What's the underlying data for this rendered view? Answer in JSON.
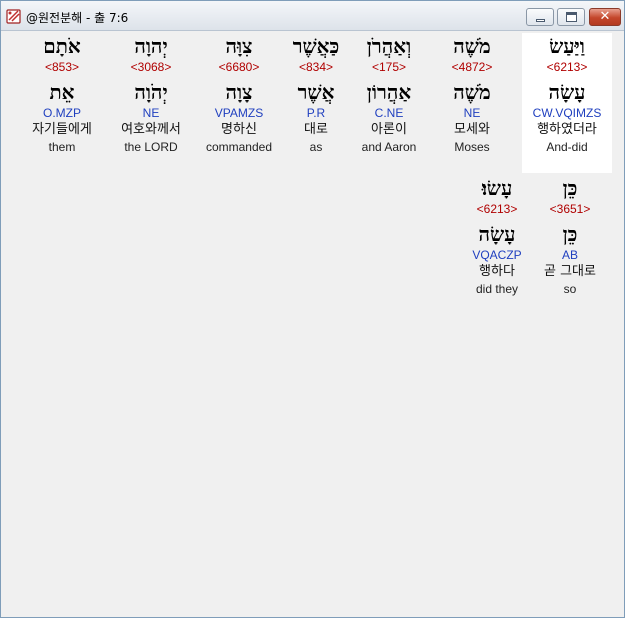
{
  "window": {
    "title": "@원전분해 - 출 7:6",
    "buttons": {
      "minimize": "minimize",
      "maximize": "maximize",
      "close": "✕"
    }
  },
  "line1": [
    {
      "heb": "וַיַּעַשׂ",
      "strong": "<6213>",
      "lemma": "עָשָׂה",
      "morph": "CW.VQIMZS",
      "kor": "행하였더라",
      "eng": "And-did"
    },
    {
      "heb": "מֹשֶׁה",
      "strong": "<4872>",
      "lemma": "מֹשֶׁה",
      "morph": "NE",
      "kor": "모세와",
      "eng": "Moses"
    },
    {
      "heb": "וְאַהֲרֹן",
      "strong": "<175>",
      "lemma": "אַהֲרוֹן",
      "morph": "C.NE",
      "kor": "아론이",
      "eng": "and Aaron"
    },
    {
      "heb": "כַּאֲשֶׁר",
      "strong": "<834>",
      "lemma": "אֲשֶׁר",
      "morph": "P.R",
      "kor": "대로",
      "eng": "as"
    },
    {
      "heb": "צִוָּה",
      "strong": "<6680>",
      "lemma": "צָוָה",
      "morph": "VPAMZS",
      "kor": "명하신",
      "eng": "commanded"
    },
    {
      "heb": "יְהוָה",
      "strong": "<3068>",
      "lemma": "יְהֹוָה",
      "morph": "NE",
      "kor": "여호와께서",
      "eng": "the LORD"
    },
    {
      "heb": "אֹתָם",
      "strong": "<853>",
      "lemma": "אֵת",
      "morph": "O.MZP",
      "kor": "자기들에게",
      "eng": "them"
    }
  ],
  "line2": [
    {
      "heb": "כֵּן",
      "strong": "<3651>",
      "lemma": "כֵּן",
      "morph": "AB",
      "kor": "곧 그대로",
      "eng": "so"
    },
    {
      "heb": "עָשׂוּ׃",
      "strong": "<6213>",
      "lemma": "עָשָׂה",
      "morph": "VQACZP",
      "kor": "행하다",
      "eng": "did they"
    }
  ]
}
